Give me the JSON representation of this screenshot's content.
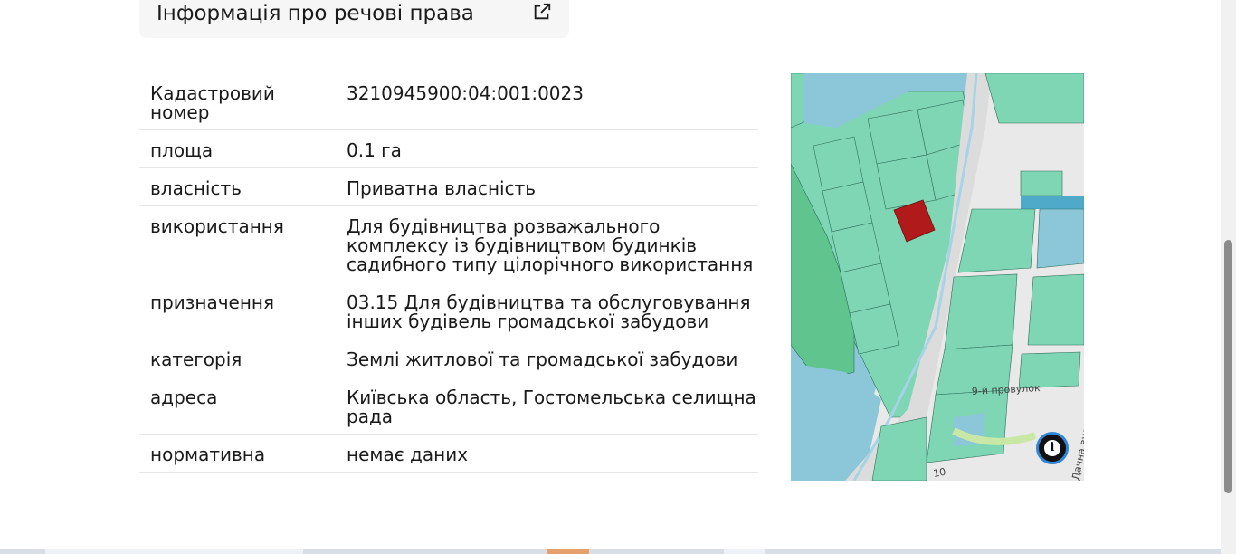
{
  "header": {
    "title": "Інформація про речові права",
    "icon": "external-link-icon"
  },
  "rows": [
    {
      "label": "Кадастровий номер",
      "value": "3210945900:04:001:0023"
    },
    {
      "label": "площа",
      "value": "0.1 га"
    },
    {
      "label": "власність",
      "value": "Приватна власність"
    },
    {
      "label": "використання",
      "value": "Для будівництва розважального комплексу із будівництвом будинків садибного типу цілорічного використання"
    },
    {
      "label": "призначення",
      "value": "03.15 Для будівництва та обслуговування інших будівель громадської забудови"
    },
    {
      "label": "категорія",
      "value": "Землі житлової та громадської забудови"
    },
    {
      "label": "адреса",
      "value": "Київська область, Гостомельська селищна рада"
    },
    {
      "label": "нормативна",
      "value": "немає даних"
    }
  ],
  "map": {
    "street_label_1": "9-й провулок",
    "street_label_2": "Дачна вули",
    "street_label_3": "10",
    "info_icon": "info-icon",
    "colors": {
      "parcel": "#7fd6b5",
      "water": "#8cc6d9",
      "highlight": "#b01a1a",
      "road": "#dcdcdc"
    }
  }
}
